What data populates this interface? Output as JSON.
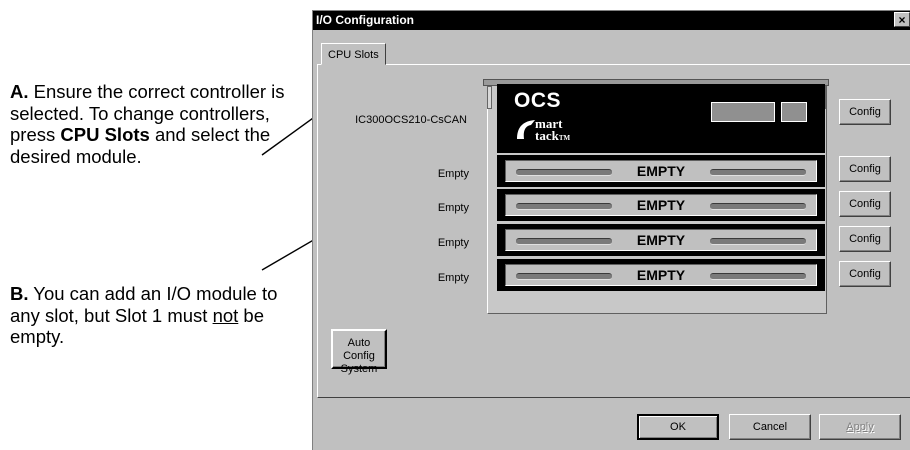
{
  "annotations": {
    "a": {
      "letter": "A.",
      "text_before": " Ensure the correct controller is selected. To change controllers, press ",
      "bold_phrase": "CPU Slots",
      "text_after": " and select the desired module."
    },
    "b": {
      "letter": "B.",
      "text_before": " You can add an I/O module to any slot, but Slot 1 must ",
      "underlined": "not",
      "text_after": " be empty."
    }
  },
  "dialog": {
    "title": "I/O Configuration",
    "close_glyph": "×",
    "tab_label": "CPU Slots",
    "cpu_slot": {
      "label": "IC300OCS210-CsCAN",
      "module_brand": "OCS",
      "logo_line1": "mart",
      "logo_line2": "tack",
      "logo_tm": "TM",
      "logo_s": "S"
    },
    "slots": [
      {
        "label": "Empty",
        "module_text": "EMPTY"
      },
      {
        "label": "Empty",
        "module_text": "EMPTY"
      },
      {
        "label": "Empty",
        "module_text": "EMPTY"
      },
      {
        "label": "Empty",
        "module_text": "EMPTY"
      }
    ],
    "config_label": "Config",
    "auto_config_label_1": "Auto Config",
    "auto_config_label_2": "System",
    "ok_label": "OK",
    "cancel_label": "Cancel",
    "apply_label": "Apply"
  },
  "colors": {
    "dialog_bg": "#c0c0c0",
    "titlebar": "#000000",
    "module_black": "#000000",
    "disabled_text": "#808080"
  }
}
